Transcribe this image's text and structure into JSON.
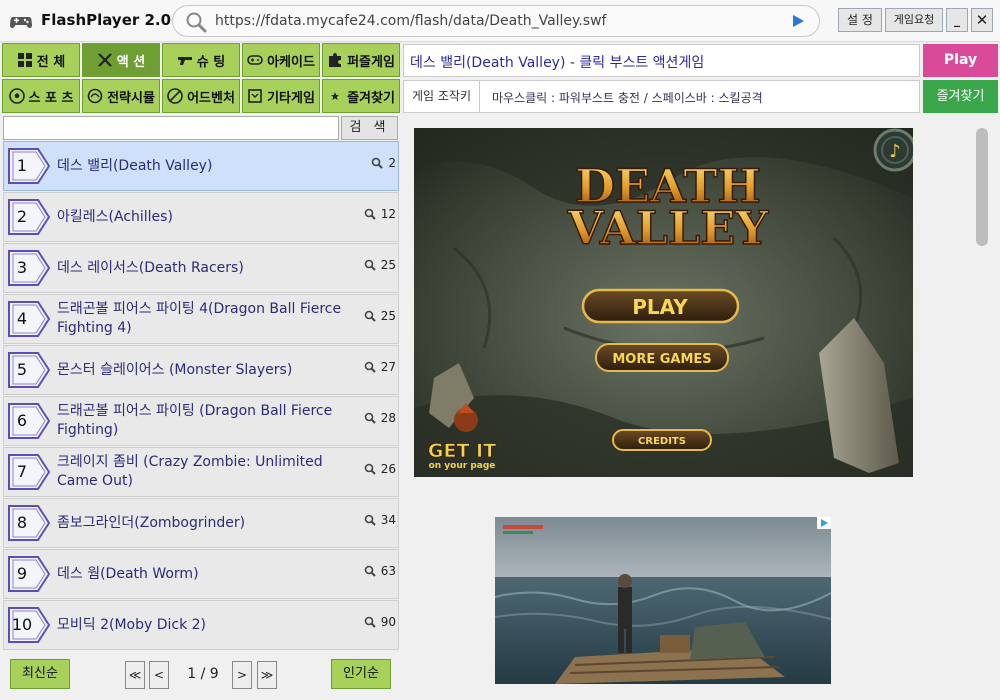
{
  "app": {
    "title": "FlashPlayer 2.0"
  },
  "urlbar": {
    "url": "https://fdata.mycafe24.com/flash/data/Death_Valley.swf"
  },
  "titlebar": {
    "settings_label": "설 정",
    "request_label": "게임요청",
    "minimize_label": "_",
    "close_label": "✕"
  },
  "categories": [
    {
      "label": "전 체",
      "icon": "grid-icon",
      "active": false
    },
    {
      "label": "액 션",
      "icon": "action-icon",
      "active": true
    },
    {
      "label": "슈 팅",
      "icon": "gun-icon",
      "active": false
    },
    {
      "label": "아케이드",
      "icon": "gamepad-icon",
      "active": false
    },
    {
      "label": "퍼즐게임",
      "icon": "puzzle-icon",
      "active": false
    },
    {
      "label": "스 포 츠",
      "icon": "soccer-ball-icon",
      "active": false
    },
    {
      "label": "전략시뮬",
      "icon": "strategy-icon",
      "active": false
    },
    {
      "label": "어드벤처",
      "icon": "adventure-icon",
      "active": false
    },
    {
      "label": "기타게임",
      "icon": "misc-icon",
      "active": false
    },
    {
      "label": "즐겨찾기",
      "icon": "star-icon",
      "active": false
    }
  ],
  "search": {
    "value": "",
    "button_label": "검 색"
  },
  "games": [
    {
      "num": "1",
      "title": "데스 밸리(Death Valley)",
      "views": "2",
      "selected": true
    },
    {
      "num": "2",
      "title": "아킬레스(Achilles)",
      "views": "12",
      "selected": false
    },
    {
      "num": "3",
      "title": "데스 레이서스(Death Racers)",
      "views": "25",
      "selected": false
    },
    {
      "num": "4",
      "title": "드래곤볼 피어스 파이팅 4(Dragon Ball Fierce Fighting 4)",
      "views": "25",
      "selected": false
    },
    {
      "num": "5",
      "title": "몬스터 슬레이어스 (Monster Slayers)",
      "views": "27",
      "selected": false
    },
    {
      "num": "6",
      "title": "드래곤볼 피어스 파이팅 (Dragon Ball Fierce Fighting)",
      "views": "28",
      "selected": false
    },
    {
      "num": "7",
      "title": "크레이지 좀비 (Crazy Zombie: Unlimited Came Out)",
      "views": "26",
      "selected": false
    },
    {
      "num": "8",
      "title": "좀보그라인더(Zombogrinder)",
      "views": "34",
      "selected": false
    },
    {
      "num": "9",
      "title": "데스 웜(Death Worm)",
      "views": "63",
      "selected": false
    },
    {
      "num": "10",
      "title": "모비딕 2(Moby Dick 2)",
      "views": "90",
      "selected": false
    }
  ],
  "pager": {
    "newest_label": "최신순",
    "popular_label": "인기순",
    "first": "≪",
    "prev": "<",
    "next": ">",
    "last": "≫",
    "page_text": "1 / 9"
  },
  "game_panel": {
    "title": "데스 밸리(Death Valley) - 클릭 부스트 액션게임",
    "play_label": "Play",
    "controls_label": "게임 조작키",
    "controls_text": "마우스클릭 : 파워부스트 충전 / 스페이스바 : 스킬공격",
    "favorite_label": "즐겨찾기"
  },
  "game_screen": {
    "logo_line1": "DEATH",
    "logo_line2": "VALLEY",
    "play_button": "PLAY",
    "more_games_button": "MORE GAMES",
    "credits_button": "CREDITS",
    "get_it_line1": "GET IT",
    "get_it_line2": "on your page"
  },
  "ad": {
    "image": "raft-on-sea-ad"
  }
}
